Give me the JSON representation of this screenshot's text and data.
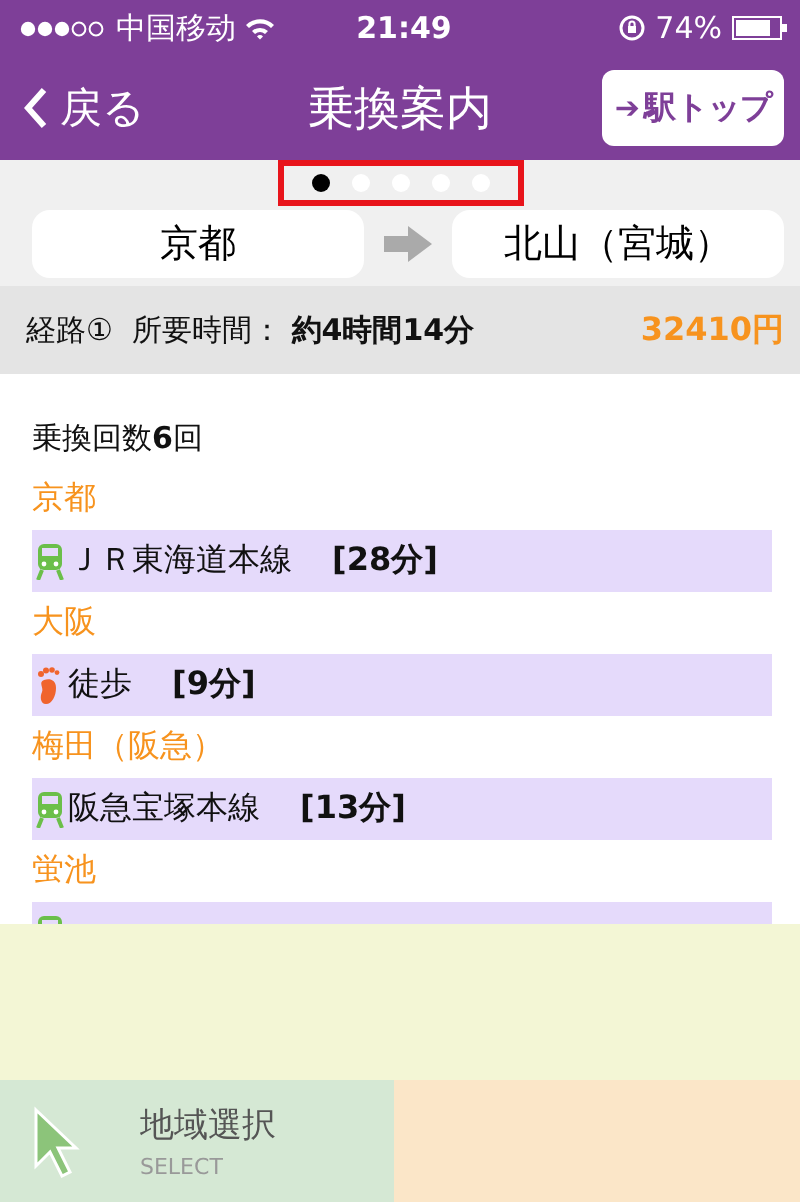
{
  "status_bar": {
    "carrier": "中国移动",
    "time": "21:49",
    "battery": "74%"
  },
  "nav": {
    "back": "戻る",
    "title": "乗換案内",
    "action_arrow": "➔",
    "action": "駅トップ"
  },
  "pager": {
    "highlighted": true,
    "dots": [
      {
        "selected": true
      },
      {
        "selected": false
      },
      {
        "selected": false
      },
      {
        "selected": false
      },
      {
        "selected": false
      }
    ]
  },
  "route_ends": {
    "from": "京都",
    "to": "北山（宮城）"
  },
  "summary": {
    "route": "経路①",
    "duration_label": "所要時間：",
    "duration": "約4時間14分",
    "fare": "32410円"
  },
  "transfers": "乗換回数**6**回",
  "steps": [
    {
      "kind": "station",
      "name": "京都"
    },
    {
      "kind": "train",
      "name": "ＪＲ東海道本線",
      "minutes": "[28分]"
    },
    {
      "kind": "station",
      "name": "大阪"
    },
    {
      "kind": "walk",
      "name": "徒歩",
      "minutes": "[9分]"
    },
    {
      "kind": "station",
      "name": "梅田（阪急）"
    },
    {
      "kind": "train",
      "name": "阪急宝塚本線",
      "minutes": "[13分]"
    },
    {
      "kind": "station",
      "name": "蛍池"
    },
    {
      "kind": "train"
    }
  ],
  "tabs": [
    {
      "label": "地域選択",
      "sublabel": "SELECT",
      "selected": true
    },
    {
      "selected": false
    }
  ]
}
